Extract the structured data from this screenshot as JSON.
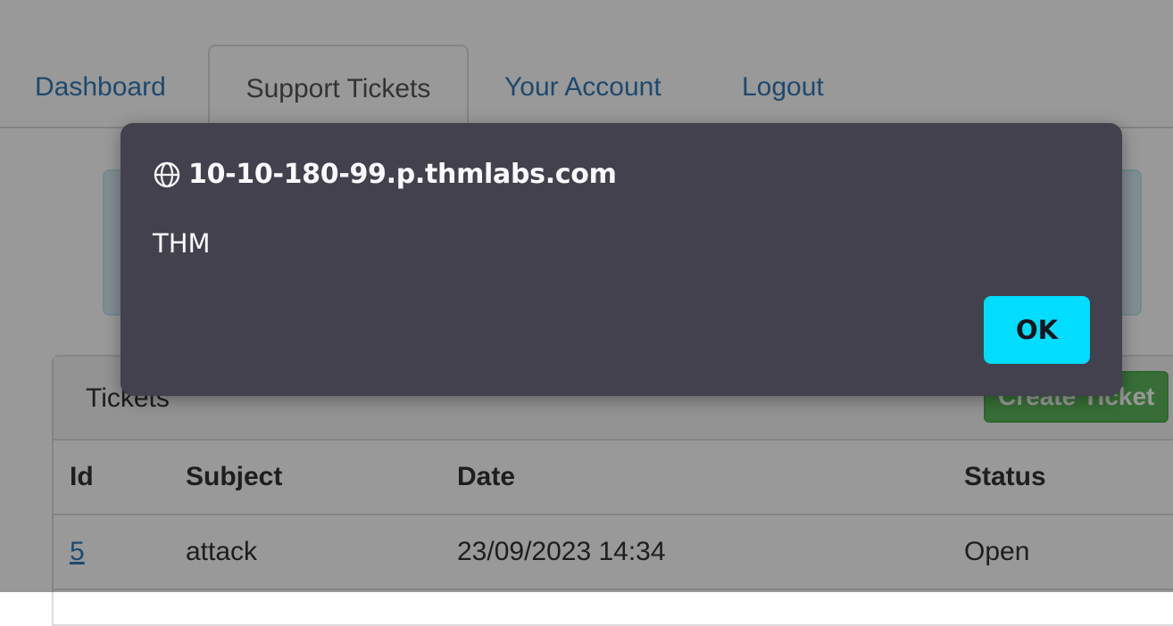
{
  "nav": {
    "tabs": [
      {
        "label": "Dashboard",
        "active": false
      },
      {
        "label": "Support Tickets",
        "active": true
      },
      {
        "label": "Your Account",
        "active": false
      },
      {
        "label": "Logout",
        "active": false
      }
    ]
  },
  "tickets_panel": {
    "title": "Tickets",
    "create_button": "Create Ticket",
    "columns": [
      "Id",
      "Subject",
      "Date",
      "Status"
    ],
    "rows": [
      {
        "id": "5",
        "subject": "attack",
        "date": "23/09/2023 14:34",
        "status": "Open"
      }
    ]
  },
  "dialog": {
    "origin": "10-10-180-99.p.thmlabs.com",
    "message": "THM",
    "ok_label": "OK",
    "icon": "globe-icon"
  },
  "colors": {
    "link": "#337ab7",
    "dialog_bg": "#42414d",
    "ok_button": "#00ddff",
    "create_button": "#5cb85c"
  }
}
